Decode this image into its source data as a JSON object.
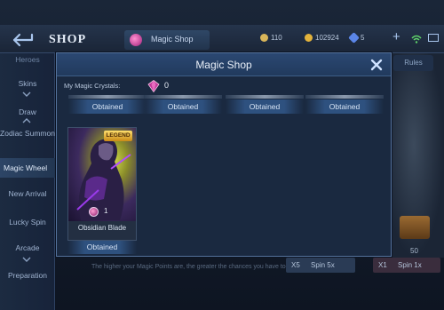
{
  "topbar": {
    "shop_title": "SHOP",
    "magic_tab_label": "Magic Shop",
    "battle_points": "110",
    "gold": "102924",
    "diamonds": "5",
    "plus": "+"
  },
  "sidebar": {
    "items": [
      {
        "label": "Heroes"
      },
      {
        "label": "Skins"
      },
      {
        "label": "Draw"
      },
      {
        "label": "Zodiac Summon"
      },
      {
        "label": "Magic Wheel"
      },
      {
        "label": "New Arrival"
      },
      {
        "label": "Lucky Spin"
      },
      {
        "label": "Arcade"
      },
      {
        "label": "Preparation"
      }
    ]
  },
  "background": {
    "rules_label": "Rules",
    "zero_label": "0",
    "fifty_label": "50",
    "footer_text": "The higher your Magic Points are, the greater the chances you have to win a Magic Crystal.",
    "spin5_count": "X5",
    "spin5_label": "Spin 5x",
    "spin1_count": "X1",
    "spin1_label": "Spin 1x"
  },
  "modal": {
    "title": "Magic Shop",
    "crystal_label": "My Magic Crystals:",
    "crystal_count": "0",
    "slots": [
      {
        "status": "Obtained"
      },
      {
        "status": "Obtained"
      },
      {
        "status": "Obtained"
      },
      {
        "status": "Obtained"
      }
    ],
    "card": {
      "badge": "LEGEND",
      "price": "1",
      "name": "Obsidian Blade",
      "status": "Obtained"
    }
  },
  "colors": {
    "accent": "#2e517f",
    "header": "#2b4872",
    "crystal": "#d24aa6",
    "badge": "#e0a52a"
  }
}
